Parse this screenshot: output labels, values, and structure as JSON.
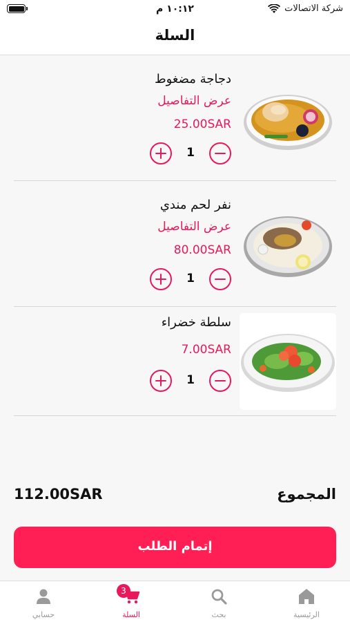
{
  "status_bar": {
    "carrier": "شركة الاتصالات",
    "time": "١٠:١٢ م"
  },
  "header": {
    "title": "السلة"
  },
  "cart": {
    "items": [
      {
        "name": "دجاجة مضغوط",
        "details_label": "عرض التفاصيل",
        "price": "25.00SAR",
        "quantity": "1"
      },
      {
        "name": "نفر لحم مندي",
        "details_label": "عرض التفاصيل",
        "price": "80.00SAR",
        "quantity": "1"
      },
      {
        "name": "سلطة خضراء",
        "price": "7.00SAR",
        "quantity": "1"
      }
    ]
  },
  "total": {
    "label": "المجموع",
    "value": "112.00SAR"
  },
  "checkout": {
    "label": "إتمام الطلب"
  },
  "bottom_nav": {
    "items": [
      {
        "label": "الرئيسية",
        "icon": "home-icon"
      },
      {
        "label": "بحث",
        "icon": "search-icon"
      },
      {
        "label": "السلة",
        "icon": "cart-icon",
        "badge": "3",
        "active": true
      },
      {
        "label": "حسابي",
        "icon": "user-icon"
      }
    ]
  },
  "colors": {
    "accent": "#e9185a",
    "checkout_button": "#ff1f55",
    "inactive_nav": "#999999"
  }
}
